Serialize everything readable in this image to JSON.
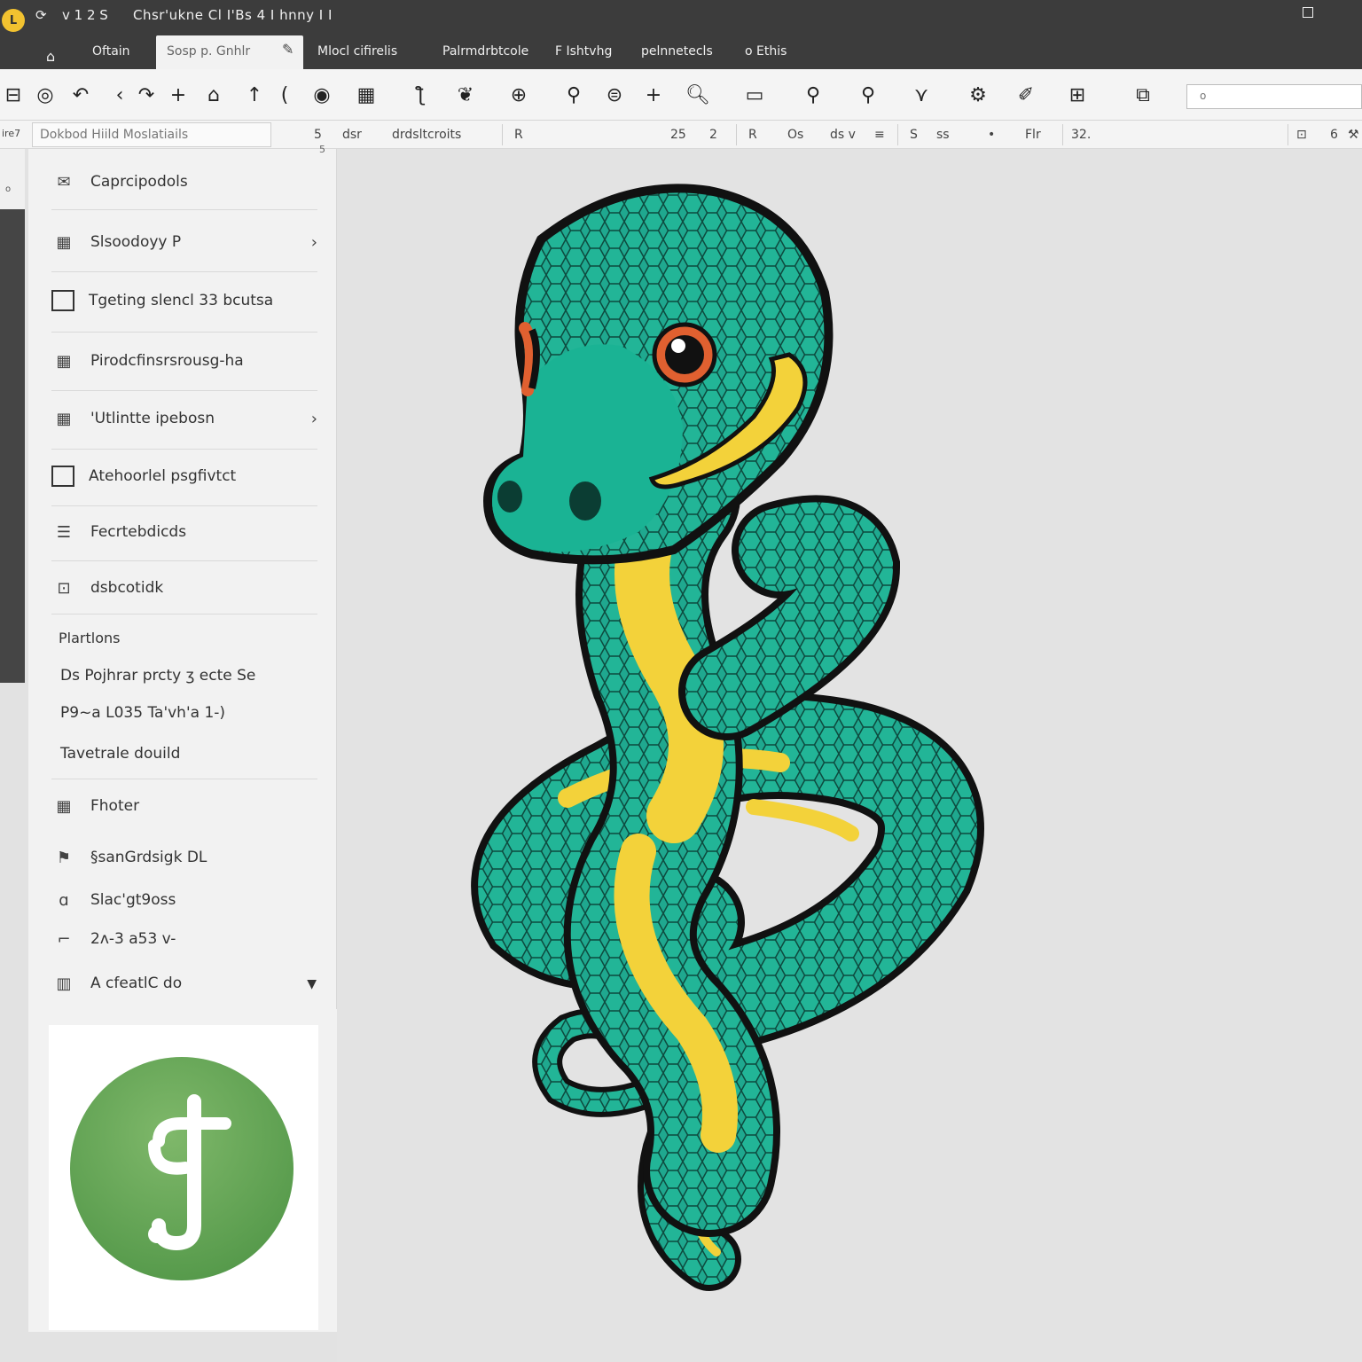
{
  "titlebar": {
    "app_icon": "L",
    "quick_access": [
      "⟳",
      "ⅴ 1 2 S"
    ],
    "title": "Chsr'ukne Cl  I'Bs  4 I hnny I I"
  },
  "tabs": [
    {
      "label": "Oftain"
    },
    {
      "label": "Sosp p. Gnhlr",
      "active": true
    },
    {
      "label": "Mlocl cifirelis"
    },
    {
      "label": "Palrmdrbtcole"
    },
    {
      "label": "F Ishtvhg"
    },
    {
      "label": "pelnnetecls"
    },
    {
      "label": "o Ethis"
    }
  ],
  "toolbar": {
    "icons": [
      "save-icon",
      "refresh-icon",
      "undo-icon",
      "redo-icon",
      "add-icon",
      "crop-icon",
      "cursor-icon",
      "back-icon",
      "eye-icon",
      "grid-icon",
      "text-icon",
      "paint-icon",
      "zoom-icon",
      "pin-icon",
      "layers-icon",
      "plus-icon",
      "search-icon",
      "frame-icon",
      "magnify-icon",
      "lens-icon",
      "vector-icon",
      "settings-icon",
      "brush-icon",
      "window-icon",
      "stack-icon"
    ],
    "search_placeholder": "o"
  },
  "formatbar": {
    "left_label": "ire7",
    "font": "Dokbod Hiild Moslatiails",
    "size": "5",
    "style_a": "dsr",
    "style_b": "drdsltcroits",
    "ruler_a": "25",
    "ruler_b": "2",
    "ruler_c": "R",
    "ruler_d": "Os",
    "ruler_e": "ds v",
    "ruler_f": "≡",
    "ruler_g": "S",
    "ruler_h": "ss",
    "ruler_i": "•",
    "ruler_j": "Flr",
    "ruler_k": "32.",
    "right_a": "6"
  },
  "sidebar": {
    "counter": "5",
    "left_strip_label": "o",
    "items": [
      {
        "label": "Caprcipodols",
        "icon": "mail-icon"
      },
      {
        "label": "Slsoodoyy P",
        "icon": "calendar-icon",
        "chevron": "›"
      },
      {
        "label": "Tgeting slencl 33 bcutsa",
        "icon": "checkbox-icon"
      },
      {
        "label": "Pirodcfinsrsrousg-ha",
        "icon": "calendar-icon"
      },
      {
        "label": "'Utlintte ipebosn",
        "icon": "calendar-icon",
        "chevron": "›"
      },
      {
        "label": "Atehoorlel psgfivtct",
        "icon": "checkbox-icon"
      },
      {
        "label": "Fecrtebdicds",
        "icon": "list-icon"
      },
      {
        "label": "dsbcotidk",
        "icon": "image-icon"
      }
    ],
    "section_title": "Plartlons",
    "plain_lines": [
      "Ds  Pojhrar prcty  ʒ ecte   Se",
      "P9~a  L035  Ta'vh'a 1-)",
      "Tavetrale douild"
    ],
    "lower_items": [
      {
        "label": "Fhoter",
        "icon": "calendar-icon"
      },
      {
        "label": "§sanGrdsigk DL",
        "icon": "flag-icon"
      },
      {
        "label": "Slac'gt9oss",
        "icon": "tag-icon"
      },
      {
        "label": "2ʌ-3 a53 v-",
        "icon": "link-icon"
      },
      {
        "label": "A cfeatlC do",
        "icon": "chart-icon"
      }
    ],
    "dropdown_arrow": "▼",
    "logo_glyph": "ʃ"
  },
  "colors": {
    "titlebar": "#3c3c3c",
    "snake_body": "#1fa88f",
    "snake_belly": "#f3d23a",
    "logo_green": "#5ea24f"
  }
}
